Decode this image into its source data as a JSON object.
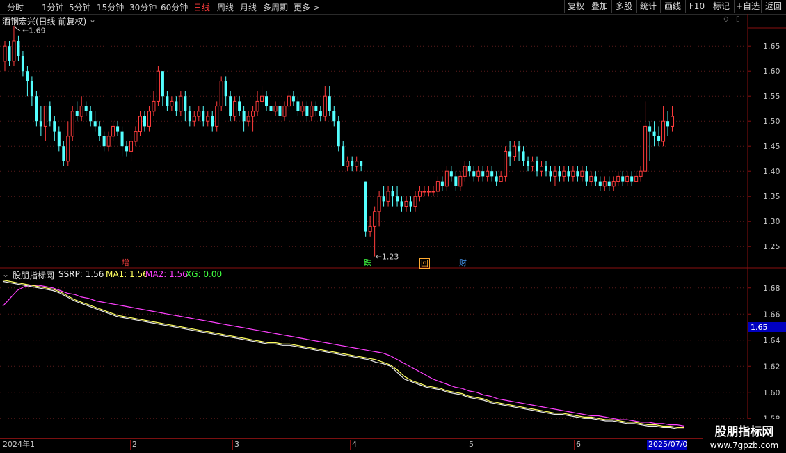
{
  "toolbar": {
    "tabs": [
      {
        "label": "分时",
        "active": false
      },
      {
        "label": "1分钟",
        "active": false
      },
      {
        "label": "5分钟",
        "active": false
      },
      {
        "label": "15分钟",
        "active": false
      },
      {
        "label": "30分钟",
        "active": false
      },
      {
        "label": "60分钟",
        "active": false
      },
      {
        "label": "日线",
        "active": true
      },
      {
        "label": "周线",
        "active": false
      },
      {
        "label": "月线",
        "active": false
      },
      {
        "label": "多周期",
        "active": false
      },
      {
        "label": "更多 >",
        "active": false
      }
    ],
    "right_buttons": [
      "复权",
      "叠加",
      "多股",
      "统计",
      "画线",
      "F10",
      "+自选",
      "返回"
    ]
  },
  "main_panel": {
    "title": "酒钢宏兴(日线 前复权)",
    "high_label": "1.69",
    "low_label": "1.23",
    "price_ticks": [
      "1.65",
      "1.60",
      "1.55",
      "1.50",
      "1.45",
      "1.40",
      "1.35",
      "1.30",
      "1.25"
    ],
    "markers": [
      {
        "text": "增",
        "color": "#ff4040"
      },
      {
        "text": "跌",
        "color": "#40ff40"
      },
      {
        "text": "回",
        "color": "#ffaa30"
      },
      {
        "text": "财",
        "color": "#4aa0ff"
      }
    ]
  },
  "indicator_panel": {
    "name": "股朋指标网",
    "values": [
      {
        "label": "SSRP: 1.56",
        "color": "#e8e8e8"
      },
      {
        "label": "MA1: 1.56",
        "color": "#ffff60"
      },
      {
        "label": "MA2: 1.56",
        "color": "#ff40ff"
      },
      {
        "label": "XG: 0.00",
        "color": "#40ff40"
      }
    ],
    "ticks": [
      "1.68",
      "1.66",
      "1.64",
      "1.62",
      "1.60",
      "1.58"
    ],
    "current_value": "1.65"
  },
  "date_axis": {
    "labels": [
      "2024年1",
      "2",
      "3",
      "4",
      "5",
      "6"
    ],
    "highlight": "2025/07/0"
  },
  "watermark": {
    "line1": "股朋指标网",
    "line2": "www.7gpzb.com"
  },
  "colors": {
    "up": "#ff3c3c",
    "down": "#54ffff",
    "grid": "#5a1a1a",
    "border": "#8a1010"
  },
  "chart_data": {
    "type": "candlestick",
    "ylim": [
      1.21,
      1.71
    ],
    "candles": [
      [
        1.62,
        1.65,
        1.66,
        1.6
      ],
      [
        1.65,
        1.62,
        1.66,
        1.61
      ],
      [
        1.62,
        1.66,
        1.69,
        1.61
      ],
      [
        1.66,
        1.63,
        1.67,
        1.62
      ],
      [
        1.63,
        1.6,
        1.64,
        1.59
      ],
      [
        1.6,
        1.58,
        1.61,
        1.55
      ],
      [
        1.58,
        1.55,
        1.59,
        1.53
      ],
      [
        1.55,
        1.5,
        1.56,
        1.49
      ],
      [
        1.5,
        1.49,
        1.53,
        1.47
      ],
      [
        1.49,
        1.53,
        1.53,
        1.46
      ],
      [
        1.53,
        1.5,
        1.54,
        1.49
      ],
      [
        1.5,
        1.48,
        1.51,
        1.46
      ],
      [
        1.48,
        1.45,
        1.49,
        1.44
      ],
      [
        1.45,
        1.42,
        1.46,
        1.41
      ],
      [
        1.42,
        1.47,
        1.5,
        1.41
      ],
      [
        1.47,
        1.52,
        1.53,
        1.46
      ],
      [
        1.52,
        1.51,
        1.54,
        1.5
      ],
      [
        1.51,
        1.53,
        1.55,
        1.5
      ],
      [
        1.53,
        1.52,
        1.54,
        1.51
      ],
      [
        1.52,
        1.5,
        1.53,
        1.49
      ],
      [
        1.5,
        1.49,
        1.52,
        1.48
      ],
      [
        1.49,
        1.47,
        1.5,
        1.46
      ],
      [
        1.47,
        1.45,
        1.48,
        1.44
      ],
      [
        1.45,
        1.47,
        1.48,
        1.44
      ],
      [
        1.47,
        1.49,
        1.5,
        1.46
      ],
      [
        1.49,
        1.48,
        1.5,
        1.47
      ],
      [
        1.48,
        1.45,
        1.49,
        1.43
      ],
      [
        1.45,
        1.44,
        1.46,
        1.43
      ],
      [
        1.44,
        1.46,
        1.47,
        1.42
      ],
      [
        1.46,
        1.48,
        1.49,
        1.45
      ],
      [
        1.48,
        1.51,
        1.52,
        1.47
      ],
      [
        1.51,
        1.49,
        1.52,
        1.48
      ],
      [
        1.49,
        1.52,
        1.53,
        1.48
      ],
      [
        1.52,
        1.54,
        1.56,
        1.51
      ],
      [
        1.54,
        1.6,
        1.61,
        1.53
      ],
      [
        1.6,
        1.55,
        1.6,
        1.53
      ],
      [
        1.55,
        1.53,
        1.56,
        1.52
      ],
      [
        1.53,
        1.54,
        1.55,
        1.52
      ],
      [
        1.54,
        1.52,
        1.55,
        1.51
      ],
      [
        1.52,
        1.55,
        1.56,
        1.51
      ],
      [
        1.55,
        1.52,
        1.56,
        1.5
      ],
      [
        1.52,
        1.5,
        1.53,
        1.49
      ],
      [
        1.5,
        1.51,
        1.52,
        1.49
      ],
      [
        1.51,
        1.52,
        1.53,
        1.5
      ],
      [
        1.52,
        1.5,
        1.53,
        1.49
      ],
      [
        1.5,
        1.51,
        1.52,
        1.49
      ],
      [
        1.51,
        1.49,
        1.52,
        1.48
      ],
      [
        1.49,
        1.53,
        1.54,
        1.48
      ],
      [
        1.53,
        1.58,
        1.59,
        1.52
      ],
      [
        1.58,
        1.55,
        1.59,
        1.53
      ],
      [
        1.55,
        1.51,
        1.56,
        1.5
      ],
      [
        1.51,
        1.54,
        1.55,
        1.5
      ],
      [
        1.54,
        1.52,
        1.55,
        1.51
      ],
      [
        1.52,
        1.5,
        1.53,
        1.48
      ],
      [
        1.5,
        1.51,
        1.52,
        1.49
      ],
      [
        1.51,
        1.52,
        1.53,
        1.48
      ],
      [
        1.52,
        1.54,
        1.56,
        1.51
      ],
      [
        1.54,
        1.55,
        1.57,
        1.53
      ],
      [
        1.55,
        1.53,
        1.56,
        1.52
      ],
      [
        1.53,
        1.52,
        1.54,
        1.51
      ],
      [
        1.52,
        1.53,
        1.54,
        1.51
      ],
      [
        1.53,
        1.51,
        1.54,
        1.5
      ],
      [
        1.51,
        1.53,
        1.54,
        1.5
      ],
      [
        1.53,
        1.55,
        1.56,
        1.52
      ],
      [
        1.55,
        1.54,
        1.56,
        1.53
      ],
      [
        1.54,
        1.52,
        1.55,
        1.51
      ],
      [
        1.52,
        1.53,
        1.54,
        1.51
      ],
      [
        1.53,
        1.51,
        1.54,
        1.5
      ],
      [
        1.51,
        1.53,
        1.54,
        1.5
      ],
      [
        1.53,
        1.52,
        1.54,
        1.51
      ],
      [
        1.52,
        1.51,
        1.53,
        1.5
      ],
      [
        1.51,
        1.55,
        1.57,
        1.5
      ],
      [
        1.55,
        1.52,
        1.57,
        1.51
      ],
      [
        1.52,
        1.5,
        1.53,
        1.49
      ],
      [
        1.5,
        1.45,
        1.51,
        1.44
      ],
      [
        1.45,
        1.41,
        1.46,
        1.41
      ],
      [
        1.41,
        1.42,
        1.43,
        1.4
      ],
      [
        1.42,
        1.41,
        1.43,
        1.4
      ],
      [
        1.41,
        1.42,
        1.43,
        1.4
      ],
      [
        1.42,
        1.41,
        1.42,
        1.4
      ],
      [
        1.38,
        1.28,
        1.38,
        1.27
      ],
      [
        1.28,
        1.29,
        1.31,
        1.27
      ],
      [
        1.29,
        1.32,
        1.33,
        1.23
      ],
      [
        1.32,
        1.35,
        1.36,
        1.29
      ],
      [
        1.35,
        1.34,
        1.37,
        1.33
      ],
      [
        1.34,
        1.36,
        1.37,
        1.33
      ],
      [
        1.36,
        1.35,
        1.37,
        1.33
      ],
      [
        1.35,
        1.34,
        1.37,
        1.33
      ],
      [
        1.34,
        1.33,
        1.35,
        1.32
      ],
      [
        1.33,
        1.34,
        1.35,
        1.32
      ],
      [
        1.34,
        1.33,
        1.35,
        1.32
      ],
      [
        1.33,
        1.35,
        1.36,
        1.32
      ],
      [
        1.35,
        1.36,
        1.37,
        1.34
      ],
      [
        1.36,
        1.36,
        1.37,
        1.35
      ],
      [
        1.36,
        1.36,
        1.37,
        1.35
      ],
      [
        1.36,
        1.36,
        1.37,
        1.35
      ],
      [
        1.36,
        1.38,
        1.39,
        1.35
      ],
      [
        1.38,
        1.37,
        1.39,
        1.36
      ],
      [
        1.37,
        1.4,
        1.41,
        1.36
      ],
      [
        1.4,
        1.39,
        1.41,
        1.38
      ],
      [
        1.39,
        1.37,
        1.4,
        1.36
      ],
      [
        1.37,
        1.39,
        1.4,
        1.36
      ],
      [
        1.39,
        1.41,
        1.42,
        1.38
      ],
      [
        1.41,
        1.4,
        1.42,
        1.39
      ],
      [
        1.4,
        1.39,
        1.41,
        1.38
      ],
      [
        1.39,
        1.4,
        1.41,
        1.38
      ],
      [
        1.4,
        1.39,
        1.41,
        1.38
      ],
      [
        1.39,
        1.4,
        1.41,
        1.38
      ],
      [
        1.4,
        1.39,
        1.41,
        1.38
      ],
      [
        1.39,
        1.38,
        1.4,
        1.37
      ],
      [
        1.38,
        1.39,
        1.4,
        1.38
      ],
      [
        1.39,
        1.44,
        1.45,
        1.38
      ],
      [
        1.44,
        1.43,
        1.46,
        1.41
      ],
      [
        1.43,
        1.45,
        1.46,
        1.42
      ],
      [
        1.45,
        1.44,
        1.46,
        1.42
      ],
      [
        1.44,
        1.42,
        1.45,
        1.41
      ],
      [
        1.42,
        1.41,
        1.43,
        1.4
      ],
      [
        1.41,
        1.42,
        1.43,
        1.4
      ],
      [
        1.42,
        1.4,
        1.43,
        1.39
      ],
      [
        1.4,
        1.41,
        1.42,
        1.39
      ],
      [
        1.41,
        1.4,
        1.42,
        1.39
      ],
      [
        1.4,
        1.39,
        1.41,
        1.38
      ],
      [
        1.39,
        1.4,
        1.41,
        1.37
      ],
      [
        1.4,
        1.39,
        1.41,
        1.38
      ],
      [
        1.39,
        1.4,
        1.41,
        1.38
      ],
      [
        1.4,
        1.39,
        1.41,
        1.38
      ],
      [
        1.39,
        1.4,
        1.41,
        1.38
      ],
      [
        1.4,
        1.39,
        1.41,
        1.38
      ],
      [
        1.39,
        1.4,
        1.41,
        1.38
      ],
      [
        1.4,
        1.38,
        1.41,
        1.37
      ],
      [
        1.38,
        1.39,
        1.4,
        1.37
      ],
      [
        1.39,
        1.38,
        1.4,
        1.37
      ],
      [
        1.38,
        1.37,
        1.39,
        1.36
      ],
      [
        1.37,
        1.38,
        1.39,
        1.36
      ],
      [
        1.38,
        1.37,
        1.39,
        1.36
      ],
      [
        1.37,
        1.38,
        1.39,
        1.36
      ],
      [
        1.38,
        1.39,
        1.4,
        1.37
      ],
      [
        1.39,
        1.38,
        1.4,
        1.37
      ],
      [
        1.38,
        1.39,
        1.4,
        1.37
      ],
      [
        1.39,
        1.38,
        1.4,
        1.37
      ],
      [
        1.38,
        1.39,
        1.4,
        1.38
      ],
      [
        1.39,
        1.4,
        1.41,
        1.38
      ],
      [
        1.4,
        1.49,
        1.54,
        1.4
      ],
      [
        1.49,
        1.48,
        1.5,
        1.42
      ],
      [
        1.48,
        1.47,
        1.5,
        1.45
      ],
      [
        1.47,
        1.46,
        1.49,
        1.45
      ],
      [
        1.46,
        1.5,
        1.53,
        1.45
      ],
      [
        1.5,
        1.49,
        1.52,
        1.47
      ],
      [
        1.49,
        1.51,
        1.53,
        1.48
      ]
    ],
    "indicator": {
      "ylim": [
        1.57,
        1.69
      ],
      "ssrp": [
        1.685,
        1.684,
        1.683,
        1.682,
        1.681,
        1.68,
        1.679,
        1.678,
        1.676,
        1.673,
        1.67,
        1.668,
        1.666,
        1.664,
        1.662,
        1.66,
        1.658,
        1.657,
        1.656,
        1.655,
        1.654,
        1.653,
        1.652,
        1.651,
        1.65,
        1.649,
        1.648,
        1.647,
        1.646,
        1.645,
        1.644,
        1.643,
        1.642,
        1.641,
        1.64,
        1.639,
        1.638,
        1.637,
        1.637,
        1.636,
        1.636,
        1.635,
        1.634,
        1.633,
        1.632,
        1.631,
        1.63,
        1.629,
        1.628,
        1.627,
        1.626,
        1.625,
        1.623,
        1.622,
        1.62,
        1.615,
        1.61,
        1.608,
        1.606,
        1.604,
        1.603,
        1.602,
        1.6,
        1.599,
        1.598,
        1.596,
        1.595,
        1.594,
        1.592,
        1.591,
        1.59,
        1.589,
        1.588,
        1.587,
        1.586,
        1.585,
        1.584,
        1.583,
        1.583,
        1.582,
        1.581,
        1.58,
        1.58,
        1.579,
        1.578,
        1.578,
        1.577,
        1.576,
        1.576,
        1.575,
        1.574,
        1.574,
        1.573,
        1.573,
        1.572,
        1.572
      ],
      "ma1": [
        1.686,
        1.685,
        1.684,
        1.683,
        1.682,
        1.681,
        1.68,
        1.679,
        1.677,
        1.674,
        1.671,
        1.669,
        1.667,
        1.665,
        1.663,
        1.661,
        1.659,
        1.658,
        1.657,
        1.656,
        1.655,
        1.654,
        1.653,
        1.652,
        1.651,
        1.65,
        1.649,
        1.648,
        1.647,
        1.646,
        1.645,
        1.644,
        1.643,
        1.642,
        1.641,
        1.64,
        1.639,
        1.638,
        1.638,
        1.637,
        1.637,
        1.636,
        1.635,
        1.634,
        1.633,
        1.632,
        1.631,
        1.63,
        1.629,
        1.628,
        1.627,
        1.626,
        1.625,
        1.623,
        1.621,
        1.617,
        1.612,
        1.609,
        1.607,
        1.605,
        1.604,
        1.603,
        1.601,
        1.6,
        1.599,
        1.597,
        1.596,
        1.595,
        1.593,
        1.592,
        1.591,
        1.59,
        1.589,
        1.588,
        1.587,
        1.586,
        1.585,
        1.584,
        1.584,
        1.583,
        1.582,
        1.581,
        1.581,
        1.58,
        1.579,
        1.579,
        1.578,
        1.577,
        1.577,
        1.576,
        1.575,
        1.575,
        1.574,
        1.574,
        1.573,
        1.573
      ],
      "ma2": [
        1.666,
        1.672,
        1.678,
        1.681,
        1.682,
        1.682,
        1.681,
        1.68,
        1.678,
        1.676,
        1.675,
        1.673,
        1.672,
        1.67,
        1.669,
        1.668,
        1.667,
        1.666,
        1.665,
        1.664,
        1.663,
        1.662,
        1.661,
        1.66,
        1.659,
        1.658,
        1.657,
        1.656,
        1.655,
        1.654,
        1.653,
        1.652,
        1.651,
        1.65,
        1.649,
        1.648,
        1.647,
        1.646,
        1.645,
        1.644,
        1.643,
        1.642,
        1.641,
        1.64,
        1.639,
        1.638,
        1.637,
        1.636,
        1.635,
        1.634,
        1.633,
        1.632,
        1.631,
        1.63,
        1.628,
        1.625,
        1.622,
        1.619,
        1.616,
        1.613,
        1.61,
        1.608,
        1.606,
        1.604,
        1.603,
        1.601,
        1.6,
        1.598,
        1.597,
        1.595,
        1.594,
        1.593,
        1.592,
        1.591,
        1.59,
        1.589,
        1.588,
        1.587,
        1.586,
        1.585,
        1.584,
        1.583,
        1.582,
        1.582,
        1.581,
        1.58,
        1.579,
        1.579,
        1.578,
        1.577,
        1.577,
        1.576,
        1.576,
        1.575,
        1.575,
        1.574
      ]
    }
  }
}
